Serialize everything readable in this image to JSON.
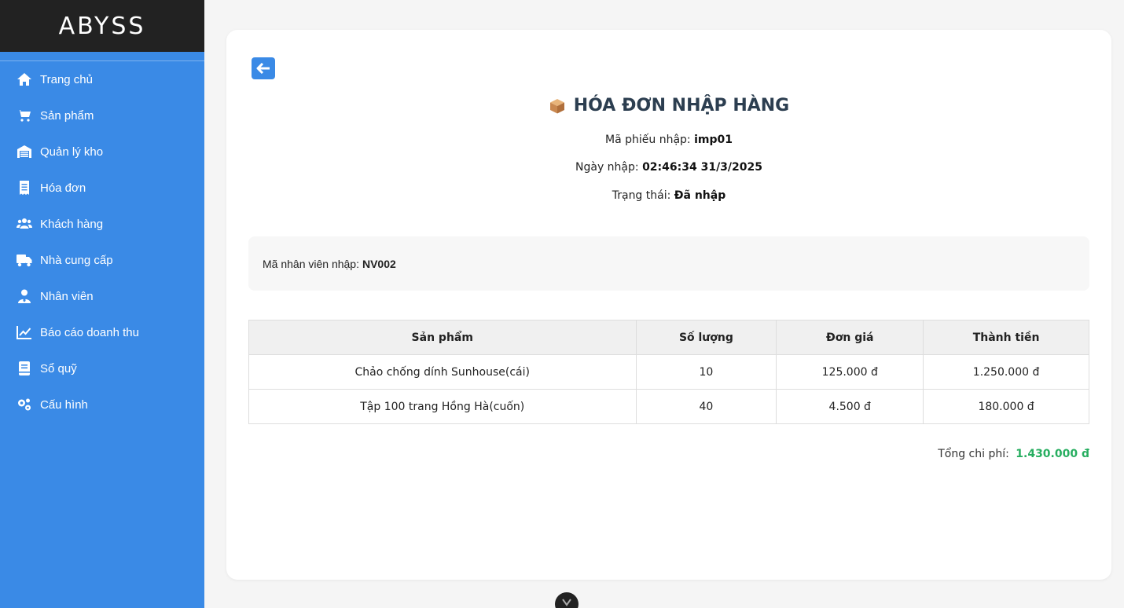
{
  "brand": {
    "name": "ABYSS"
  },
  "sidebar": {
    "items": [
      {
        "label": "Trang chủ",
        "icon": "home-icon"
      },
      {
        "label": "Sản phẩm",
        "icon": "cart-icon"
      },
      {
        "label": "Quản lý kho",
        "icon": "warehouse-icon"
      },
      {
        "label": "Hóa đơn",
        "icon": "receipt-icon"
      },
      {
        "label": "Khách hàng",
        "icon": "users-icon"
      },
      {
        "label": "Nhà cung cấp",
        "icon": "truck-icon"
      },
      {
        "label": "Nhân viên",
        "icon": "user-tie-icon"
      },
      {
        "label": "Báo cáo doanh thu",
        "icon": "chart-line-icon"
      },
      {
        "label": "Sổ quỹ",
        "icon": "book-icon"
      },
      {
        "label": "Cấu hình",
        "icon": "cogs-icon"
      }
    ]
  },
  "invoice": {
    "title": "HÓA ĐƠN NHẬP HÀNG",
    "code_label": "Mã phiếu nhập:",
    "code_value": "imp01",
    "date_label": "Ngày nhập:",
    "date_value": "02:46:34 31/3/2025",
    "status_label": "Trạng thái:",
    "status_value": "Đã nhập",
    "employee_label": "Mã nhân viên nhập:",
    "employee_value": "NV002"
  },
  "table": {
    "headers": [
      "Sản phẩm",
      "Số lượng",
      "Đơn giá",
      "Thành tiền"
    ],
    "rows": [
      [
        "Chảo chống dính Sunhouse(cái)",
        "10",
        "125.000 đ",
        "1.250.000 đ"
      ],
      [
        "Tập 100 trang Hồng Hà(cuốn)",
        "40",
        "4.500 đ",
        "180.000 đ"
      ]
    ]
  },
  "total": {
    "label": "Tổng chi phí:",
    "value": "1.430.000 đ"
  },
  "colors": {
    "sidebar": "#3a8ae6",
    "brand_bg": "#222222",
    "total": "#27ae60",
    "title": "#2c3e50"
  }
}
